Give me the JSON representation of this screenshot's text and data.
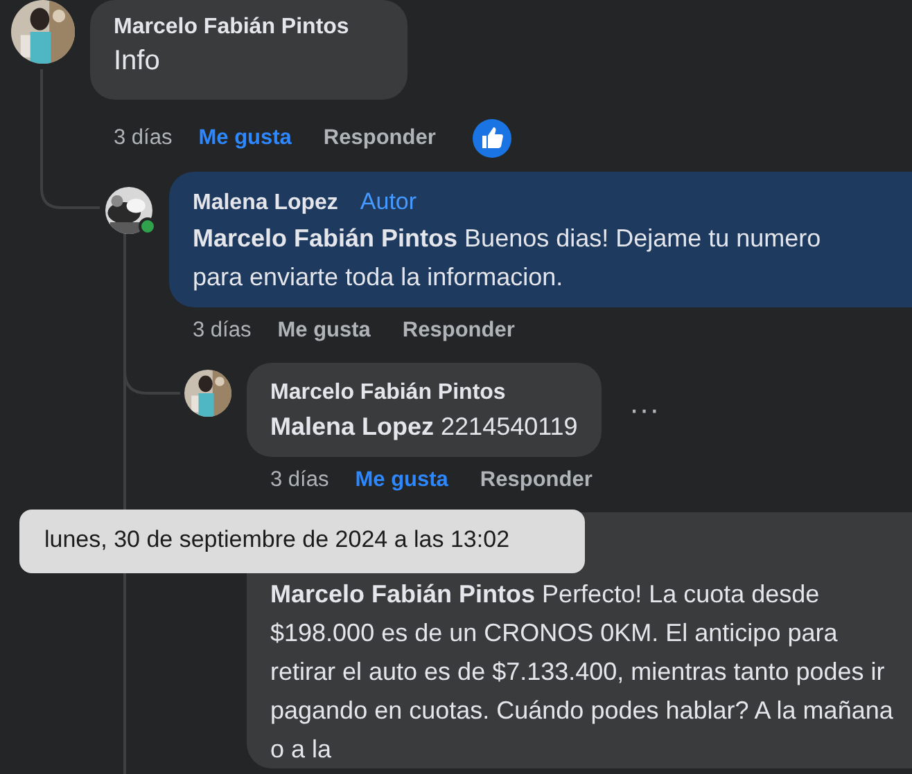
{
  "comments": [
    {
      "author": "Marcelo Fabián Pintos",
      "text": "Info",
      "time": "3 días",
      "like": {
        "label": "Me gusta",
        "selected": true
      },
      "reply": "Responder",
      "reaction": true,
      "children": [
        {
          "author": "Malena Lopez",
          "badge": "Autor",
          "mention": "Marcelo Fabián Pintos",
          "text": "Buenos dias! Dejame tu numero para enviarte toda la informacion.",
          "time": "3 días",
          "like": {
            "label": "Me gusta",
            "selected": false
          },
          "reply": "Responder",
          "online": true,
          "children": [
            {
              "author": "Marcelo Fabián Pintos",
              "mention": "Malena Lopez",
              "text": "2214540119",
              "time": "3 días",
              "like": {
                "label": "Me gusta",
                "selected": true
              },
              "reply": "Responder",
              "more": "···"
            },
            {
              "mention": "Marcelo Fabián Pintos",
              "text": "Perfecto! La cuota desde $198.000 es de un CRONOS 0KM. El anticipo para retirar el auto es de $7.133.400, mientras tanto podes ir pagando en cuotas. Cuándo podes hablar? A la mañana o a la"
            }
          ]
        }
      ]
    }
  ],
  "tooltip": {
    "text": "lunes, 30 de septiembre de 2024 a las 13:02"
  }
}
